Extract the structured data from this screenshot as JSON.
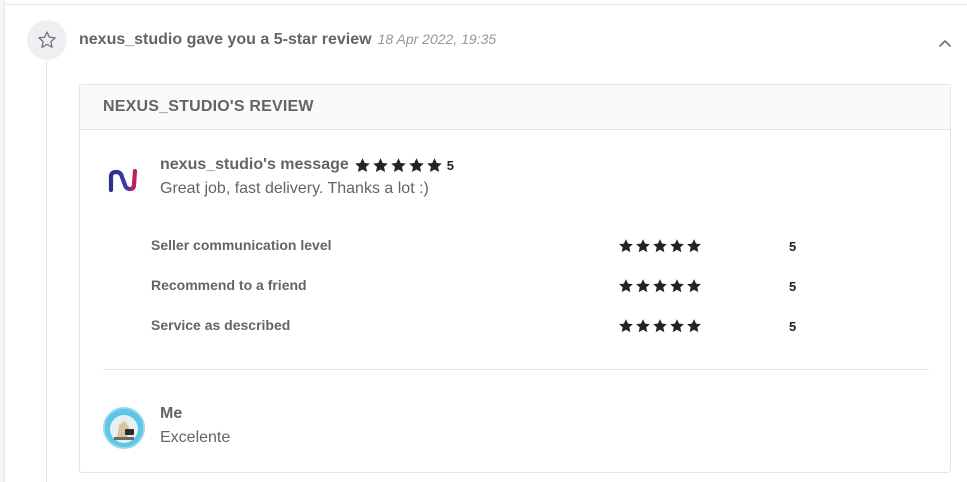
{
  "notification": {
    "title": "nexus_studio gave you a 5-star review",
    "date": "18 Apr 2022, 19:35",
    "star_icon": "star-outline-icon",
    "collapse_icon": "chevron-up-icon"
  },
  "review": {
    "header": "NEXUS_STUDIO'S REVIEW",
    "seller": {
      "message_title": "nexus_studio's message",
      "rating": 5,
      "rating_text": "5",
      "message": "Great job, fast delivery. Thanks a lot :)",
      "logo_icon": "nexus-logo-icon",
      "logo_colors": [
        "#2d2f8f",
        "#c8205c"
      ]
    },
    "ratings": [
      {
        "label": "Seller communication level",
        "value": 5,
        "value_text": "5"
      },
      {
        "label": "Recommend to a friend",
        "value": 5,
        "value_text": "5"
      },
      {
        "label": "Service as described",
        "value": 5,
        "value_text": "5"
      }
    ],
    "reply": {
      "name": "Me",
      "text": "Excelente"
    }
  },
  "colors": {
    "star": "#222325",
    "text": "#62646a",
    "muted": "#95979d",
    "border": "#e4e5e7"
  }
}
